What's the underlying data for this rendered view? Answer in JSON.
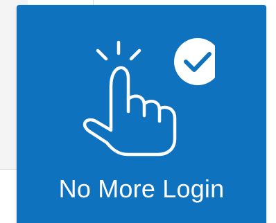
{
  "card": {
    "title": "No More Login",
    "icon": "tap-gesture-checkmark-icon"
  },
  "colors": {
    "card_background": "#0f72bf",
    "foreground": "#ffffff",
    "check_stroke": "#0f72bf"
  }
}
